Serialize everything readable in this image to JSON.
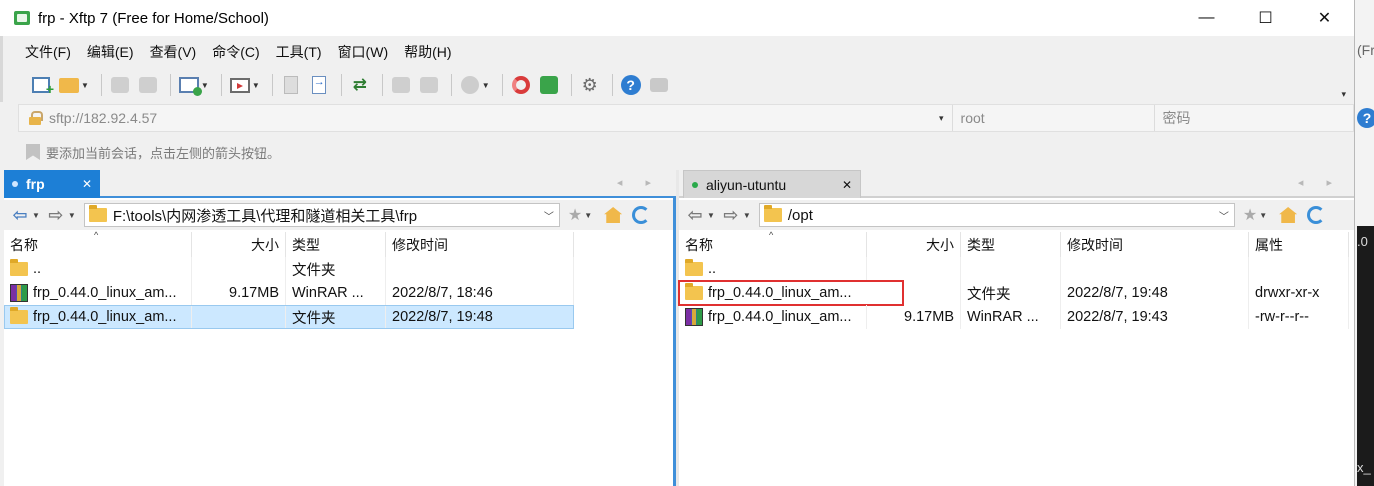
{
  "window": {
    "title": "frp - Xftp 7 (Free for Home/School)",
    "controls": {
      "minimize": "—",
      "maximize": "☐",
      "close": "✕"
    }
  },
  "menu": [
    "文件(F)",
    "编辑(E)",
    "查看(V)",
    "命令(C)",
    "工具(T)",
    "窗口(W)",
    "帮助(H)"
  ],
  "toolbar": {
    "more_glyph": "▾",
    "icons": [
      "new-session-icon",
      "open-folder-icon",
      "disconnect-icon",
      "reconnect-icon",
      "session-properties-icon",
      "transfer-icon",
      "delete-icon",
      "open-remote-icon",
      "sync-icon",
      "copy-icon",
      "paste-icon",
      "globe-icon",
      "xshell-icon",
      "xftp-icon",
      "gear-icon",
      "help-icon",
      "chat-icon"
    ]
  },
  "address": {
    "url_placeholder": "sftp://182.92.4.57",
    "user_placeholder": "root",
    "password_placeholder": "密码",
    "dropdown_glyph": "▾"
  },
  "hint": {
    "text": "要添加当前会话，点击左侧的箭头按钮。"
  },
  "left": {
    "tab": {
      "label": "frp",
      "close": "✕"
    },
    "tab_nav": "◂ ▸",
    "path": "F:\\tools\\内网渗透工具\\代理和隧道相关工具\\frp",
    "columns": [
      "名称",
      "大小",
      "类型",
      "修改时间"
    ],
    "sort_glyph": "^",
    "rows": [
      {
        "icon": "folder-icon",
        "name": "..",
        "size": "",
        "type": "文件夹",
        "modified": ""
      },
      {
        "icon": "rar-icon",
        "name": "frp_0.44.0_linux_am...",
        "size": "9.17MB",
        "type": "WinRAR ...",
        "modified": "2022/8/7, 18:46"
      },
      {
        "icon": "folder-icon",
        "name": "frp_0.44.0_linux_am...",
        "size": "",
        "type": "文件夹",
        "modified": "2022/8/7, 19:48"
      }
    ],
    "selected_row": 2
  },
  "right": {
    "tab": {
      "label": "aliyun-utuntu",
      "close": "✕"
    },
    "tab_nav": "◂ ▸",
    "path": "/opt",
    "columns": [
      "名称",
      "大小",
      "类型",
      "修改时间",
      "属性"
    ],
    "sort_glyph": "^",
    "rows": [
      {
        "icon": "folder-icon",
        "name": "..",
        "size": "",
        "type": "",
        "modified": "",
        "attr": ""
      },
      {
        "icon": "folder-icon",
        "name": "frp_0.44.0_linux_am...",
        "size": "",
        "type": "文件夹",
        "modified": "2022/8/7, 19:48",
        "attr": "drwxr-xr-x"
      },
      {
        "icon": "rar-icon",
        "name": "frp_0.44.0_linux_am...",
        "size": "9.17MB",
        "type": "WinRAR ...",
        "modified": "2022/8/7, 19:43",
        "attr": "-rw-r--r--"
      }
    ],
    "highlighted_row": 1
  },
  "background_app": {
    "text1": "(Fr",
    "text2": ".0",
    "text3": "x_"
  },
  "colors": {
    "accent": "#1d7fd6",
    "selection": "#cce8ff",
    "highlight_box": "#e03030"
  }
}
